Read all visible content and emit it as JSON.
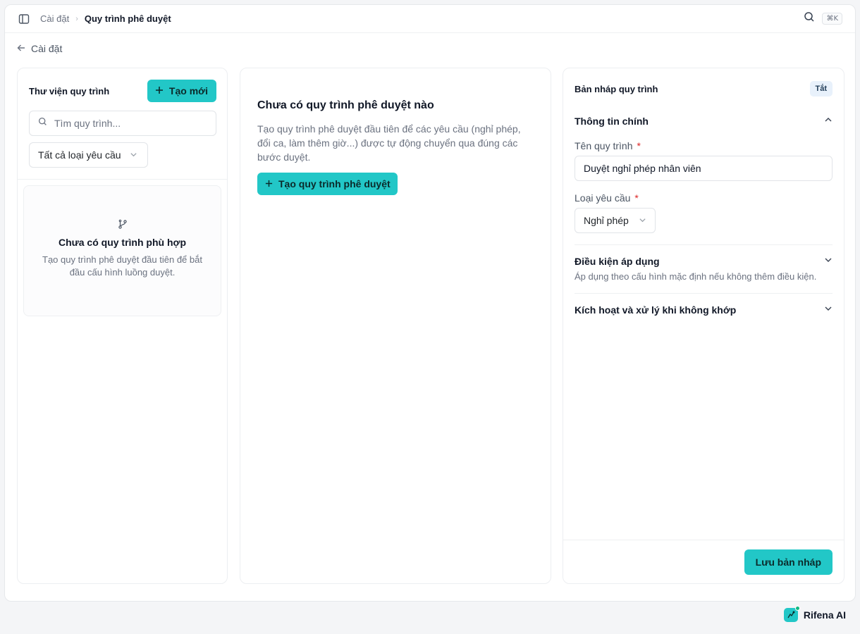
{
  "topbar": {
    "breadcrumb_parent": "Cài đặt",
    "breadcrumb_current": "Quy trình phê duyệt",
    "shortcut": "⌘K"
  },
  "back_label": "Cài đặt",
  "library": {
    "title": "Thư viện quy trình",
    "new_button": "Tạo mới",
    "search_placeholder": "Tìm quy trình...",
    "type_filter": "Tất cả loại yêu cầu",
    "empty_title": "Chưa có quy trình phù hợp",
    "empty_desc": "Tạo quy trình phê duyệt đầu tiên để bắt đầu cấu hình luồng duyệt."
  },
  "main": {
    "title": "Chưa có quy trình phê duyệt nào",
    "description": "Tạo quy trình phê duyệt đầu tiên để các yêu cầu (nghỉ phép, đổi ca, làm thêm giờ...) được tự động chuyển qua đúng các bước duyệt.",
    "create_button": "Tạo quy trình phê duyệt"
  },
  "draft": {
    "title": "Bản nháp quy trình",
    "status_badge": "Tắt",
    "sections": [
      {
        "title": "Thông tin chính",
        "name_label": "Tên quy trình",
        "name_value": "Duyệt nghỉ phép nhân viên",
        "type_label": "Loại yêu cầu",
        "type_value": "Nghỉ phép",
        "required_mark": "*"
      },
      {
        "title": "Điều kiện áp dụng",
        "description": "Áp dụng theo cấu hình mặc định nếu không thêm điều kiện."
      },
      {
        "title": "Kích hoạt và xử lý khi không khớp"
      }
    ],
    "save_button": "Lưu bản nháp"
  },
  "brand": "Rifena AI",
  "colors": {
    "accent": "#22c7c7",
    "required": "#dc2626",
    "badge_bg": "#e8f1fb"
  }
}
